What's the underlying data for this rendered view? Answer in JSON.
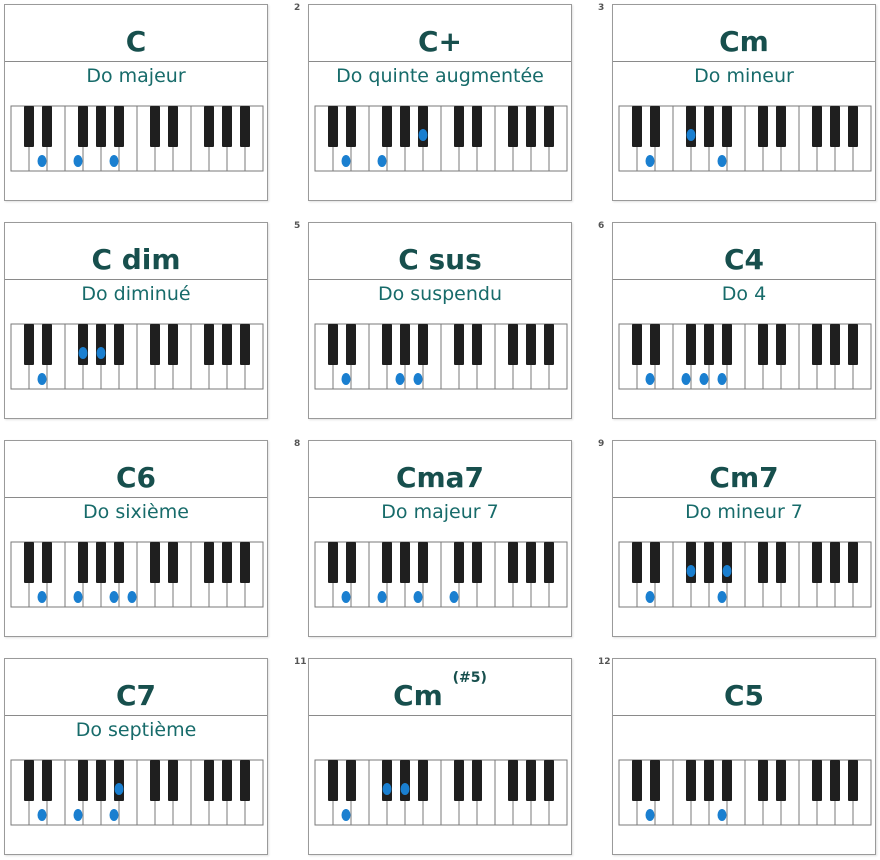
{
  "colors": {
    "title": "#174f4d",
    "subtitle": "#176b6a",
    "dot": "#1a7fd0",
    "black_key": "#1f1f1f",
    "white_key": "#ffffff"
  },
  "chords": [
    {
      "title": "C",
      "sup": "",
      "subtitle": "Do majeur",
      "number": "",
      "white_dots": [
        2,
        4,
        6
      ],
      "black_dots": []
    },
    {
      "title": "C+",
      "sup": "",
      "subtitle": "Do quinte augmentée",
      "number": "2",
      "white_dots": [
        2,
        4
      ],
      "black_dots": [
        4
      ]
    },
    {
      "title": "Cm",
      "sup": "",
      "subtitle": "Do mineur",
      "number": "3",
      "white_dots": [
        2,
        6
      ],
      "black_dots": [
        2
      ]
    },
    {
      "title": "C dim",
      "sup": "",
      "subtitle": "Do diminué",
      "number": "",
      "white_dots": [
        2
      ],
      "black_dots": [
        2,
        3
      ]
    },
    {
      "title": "C sus",
      "sup": "",
      "subtitle": "Do suspendu",
      "number": "5",
      "white_dots": [
        2,
        5,
        6
      ],
      "black_dots": []
    },
    {
      "title": "C4",
      "sup": "",
      "subtitle": "Do 4",
      "number": "6",
      "white_dots": [
        2,
        4,
        5,
        6
      ],
      "black_dots": []
    },
    {
      "title": "C6",
      "sup": "",
      "subtitle": "Do sixième",
      "number": "",
      "white_dots": [
        2,
        4,
        6,
        7
      ],
      "black_dots": []
    },
    {
      "title": "Cma7",
      "sup": "",
      "subtitle": "Do majeur 7",
      "number": "8",
      "white_dots": [
        2,
        4,
        6,
        8
      ],
      "black_dots": []
    },
    {
      "title": "Cm7",
      "sup": "",
      "subtitle": "Do mineur 7",
      "number": "9",
      "white_dots": [
        2,
        6
      ],
      "black_dots": [
        2,
        4
      ]
    },
    {
      "title": "C7",
      "sup": "",
      "subtitle": "Do septième",
      "number": "",
      "white_dots": [
        2,
        4,
        6
      ],
      "black_dots": [
        4
      ]
    },
    {
      "title": "Cm",
      "sup": "(#5)",
      "subtitle": "",
      "number": "11",
      "white_dots": [
        2
      ],
      "black_dots": [
        2,
        3
      ]
    },
    {
      "title": "C5",
      "sup": "",
      "subtitle": "",
      "number": "12",
      "white_dots": [
        2,
        6
      ],
      "black_dots": []
    }
  ]
}
